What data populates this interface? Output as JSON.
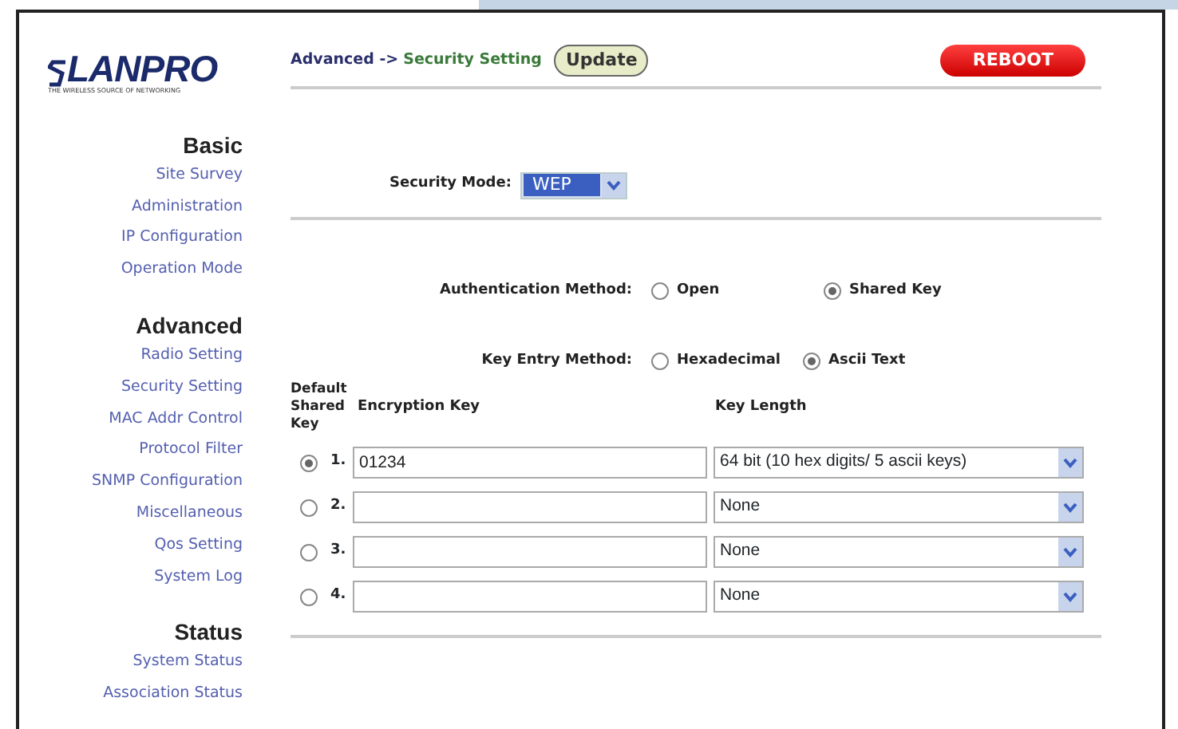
{
  "logo": {
    "name": "LANPRO",
    "tagline": "THE WIRELESS SOURCE OF NETWORKING"
  },
  "sidebar": [
    {
      "heading": "Basic",
      "items": [
        "Site Survey",
        "Administration",
        "IP Configuration",
        "Operation Mode"
      ]
    },
    {
      "heading": "Advanced",
      "items": [
        "Radio Setting",
        "Security Setting",
        "MAC Addr Control",
        "Protocol Filter",
        "SNMP Configuration",
        "Miscellaneous",
        "Qos Setting",
        "System Log"
      ]
    },
    {
      "heading": "Status",
      "items": [
        "System Status",
        "Association Status"
      ]
    }
  ],
  "breadcrumb": {
    "section": "Advanced ->",
    "page": "Security Setting"
  },
  "update_button": "Update",
  "reboot_button": "REBOOT",
  "security_mode": {
    "label": "Security Mode:",
    "value": "WEP"
  },
  "auth_method": {
    "label": "Authentication Method:",
    "options": [
      {
        "label": "Open",
        "selected": false
      },
      {
        "label": "Shared Key",
        "selected": true
      }
    ]
  },
  "key_entry_method": {
    "label": "Key Entry Method:",
    "options": [
      {
        "label": "Hexadecimal",
        "selected": false
      },
      {
        "label": "Ascii Text",
        "selected": true
      }
    ]
  },
  "keys_table": {
    "columns": [
      "Default Shared Key",
      "Encryption Key",
      "Key Length"
    ],
    "rows": [
      {
        "index": "1.",
        "selected": true,
        "key": "01234",
        "length": "64 bit (10 hex digits/ 5 ascii keys)"
      },
      {
        "index": "2.",
        "selected": false,
        "key": "",
        "length": "None"
      },
      {
        "index": "3.",
        "selected": false,
        "key": "",
        "length": "None"
      },
      {
        "index": "4.",
        "selected": false,
        "key": "",
        "length": "None"
      }
    ]
  }
}
